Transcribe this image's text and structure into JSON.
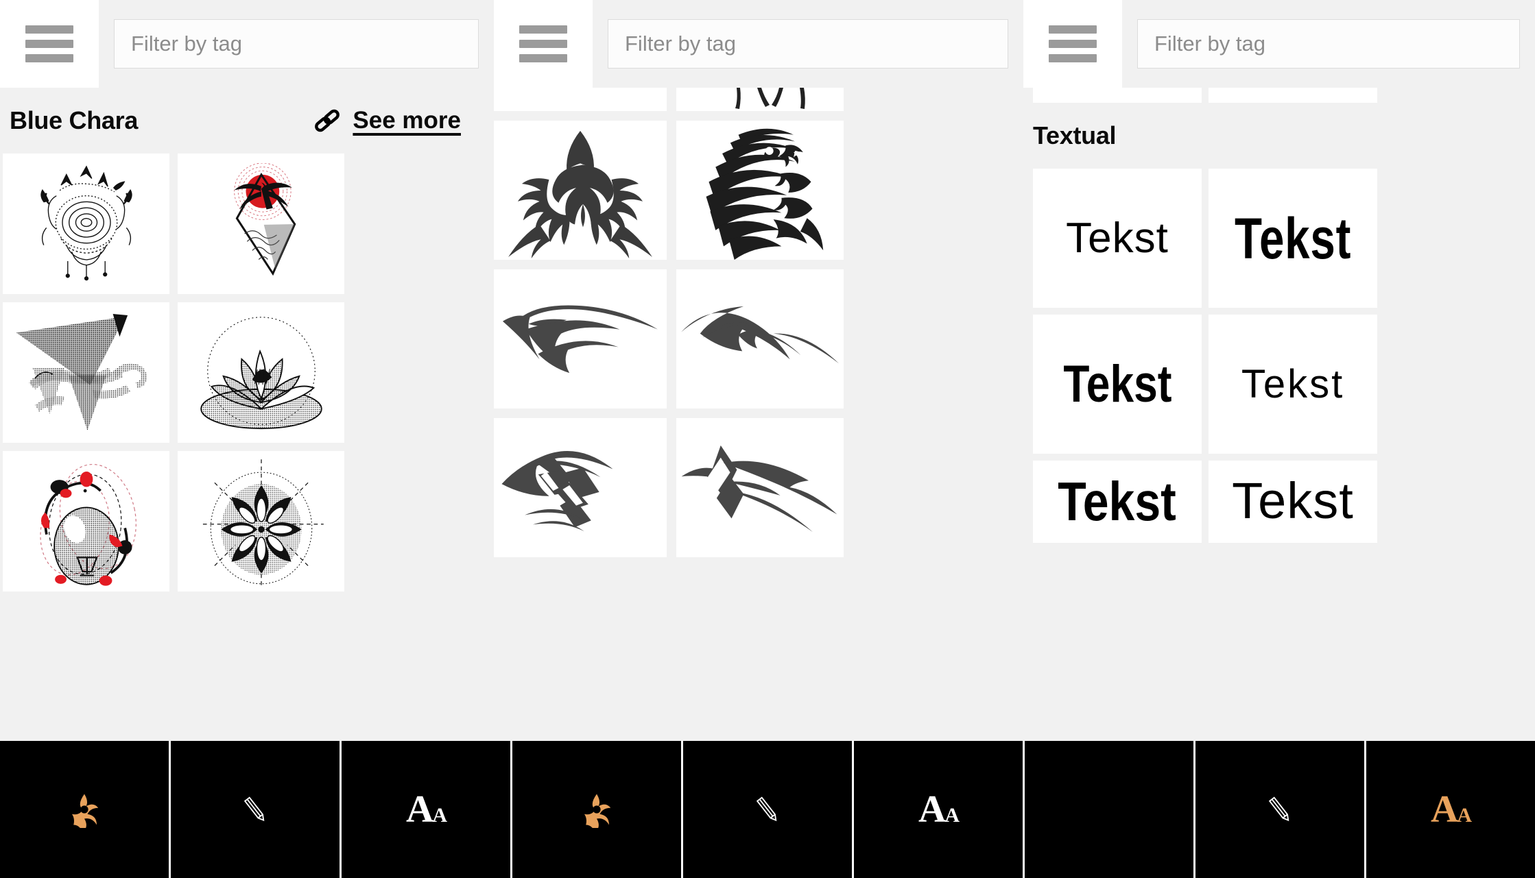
{
  "app": {
    "background": "#f1f1f1",
    "panel_background": "#ffffff",
    "accent_orange": "#e8a25c",
    "bottom_bar_color": "#000000"
  },
  "panels": [
    {
      "id": "panel-tattoos",
      "menu_icon": "hamburger-menu-icon",
      "filter": {
        "placeholder": "Filter by tag",
        "value": ""
      },
      "section": {
        "title": "Blue Chara",
        "link_icon": "chain-link-icon",
        "see_more_label": "See more"
      },
      "items": [
        {
          "name": "rose-mandala-dotwork-tattoo",
          "kind": "graphic"
        },
        {
          "name": "palm-tree-red-sun-diamond-tattoo",
          "kind": "graphic"
        },
        {
          "name": "geometric-lion-dotwork-tattoo",
          "kind": "graphic"
        },
        {
          "name": "lotus-flower-dotwork-tattoo",
          "kind": "graphic"
        },
        {
          "name": "lightbulb-orbit-red-dots-tattoo",
          "kind": "graphic"
        },
        {
          "name": "mandala-flower-dotwork-tattoo",
          "kind": "graphic"
        }
      ],
      "tabs": [
        {
          "icon": "flame-icon",
          "selected": true,
          "color": "#e8a25c"
        },
        {
          "icon": "pencil-icon",
          "selected": false,
          "color": "#ffffff"
        },
        {
          "icon": "text-aa-icon",
          "label": "Aa",
          "selected": false,
          "color": "#ffffff"
        }
      ]
    },
    {
      "id": "panel-tribal",
      "menu_icon": "hamburger-menu-icon",
      "filter": {
        "placeholder": "Filter by tag",
        "value": ""
      },
      "section": {
        "title": ""
      },
      "items": [
        {
          "name": "tribal-partial-top-left",
          "kind": "graphic"
        },
        {
          "name": "tribal-partial-top-right",
          "kind": "graphic"
        },
        {
          "name": "tribal-squid-tattoo",
          "kind": "graphic"
        },
        {
          "name": "tribal-panther-head-tattoo",
          "kind": "graphic"
        },
        {
          "name": "tribal-swoosh-arrow-left",
          "kind": "graphic"
        },
        {
          "name": "tribal-swoosh-wing-right",
          "kind": "graphic"
        },
        {
          "name": "tribal-knot-swoosh",
          "kind": "graphic"
        },
        {
          "name": "tribal-diamond-swoosh",
          "kind": "graphic"
        }
      ],
      "tabs": [
        {
          "icon": "flame-icon",
          "selected": true,
          "color": "#e8a25c"
        },
        {
          "icon": "pencil-icon",
          "selected": false,
          "color": "#ffffff"
        },
        {
          "icon": "text-aa-icon",
          "label": "Aa",
          "selected": false,
          "color": "#ffffff"
        }
      ]
    },
    {
      "id": "panel-textual",
      "menu_icon": "hamburger-menu-icon",
      "filter": {
        "placeholder": "Filter by tag",
        "value": ""
      },
      "section": {
        "title": "Textual"
      },
      "items": [
        {
          "name": "font-sample",
          "label": "Tekst",
          "style": "regular-light"
        },
        {
          "name": "font-sample",
          "label": "Tekst",
          "style": "bold-condensed"
        },
        {
          "name": "font-sample",
          "label": "Tekst",
          "style": "heavy-condensed"
        },
        {
          "name": "font-sample",
          "label": "Tekst",
          "style": "thin-wide"
        },
        {
          "name": "font-sample",
          "label": "Tekst",
          "style": "bold-serifless"
        },
        {
          "name": "font-sample",
          "label": "Tekst",
          "style": "regular-wide"
        }
      ],
      "tabs": [
        {
          "icon": "flame-icon",
          "selected": false,
          "color": "#000000"
        },
        {
          "icon": "pencil-icon",
          "selected": false,
          "color": "#ffffff"
        },
        {
          "icon": "text-aa-icon",
          "label": "Aa",
          "selected": true,
          "color": "#e8a25c"
        }
      ]
    }
  ],
  "bottom_bar": {
    "tabs": [
      {
        "icon": "flame-icon",
        "label": "",
        "state": "selected"
      },
      {
        "icon": "pencil-icon",
        "label": "",
        "state": "unselected"
      },
      {
        "icon": "text-aa-icon",
        "label": "Aa",
        "state": "unselected"
      },
      {
        "icon": "flame-icon",
        "label": "",
        "state": "selected"
      },
      {
        "icon": "pencil-icon",
        "label": "",
        "state": "unselected"
      },
      {
        "icon": "text-aa-icon",
        "label": "Aa",
        "state": "unselected"
      },
      {
        "icon": "flame-icon",
        "label": "",
        "state": "hidden"
      },
      {
        "icon": "pencil-icon",
        "label": "",
        "state": "unselected"
      },
      {
        "icon": "text-aa-icon",
        "label": "Aa",
        "state": "selected"
      }
    ]
  }
}
